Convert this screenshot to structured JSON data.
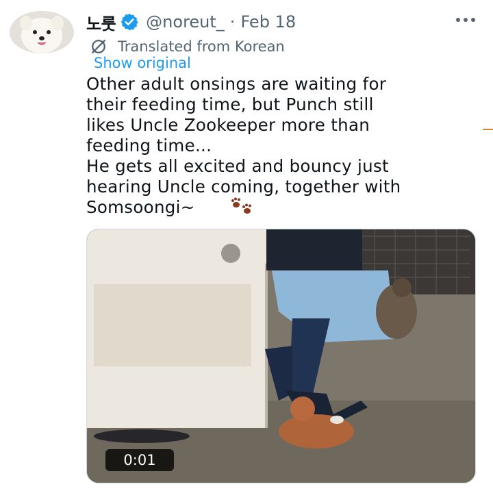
{
  "tweet": {
    "author_name": "노룻",
    "handle": "@noreut_",
    "separator": "·",
    "date": "Feb 18",
    "translated_label": "Translated from Korean",
    "show_original": "Show original",
    "text": "Other adult onsings are waiting for\ntheir feeding time, but Punch still\nlikes Uncle Zookeeper more than\nfeeding time...\nHe gets all excited and bouncy just\nhearing Uncle coming, together with\nSomsoongi~",
    "emoji": "paw-prints-icon",
    "video_duration": "0:01"
  },
  "colors": {
    "accent": "#1d9bf0",
    "secondary_text": "#536471",
    "primary_text": "#0f1419"
  }
}
